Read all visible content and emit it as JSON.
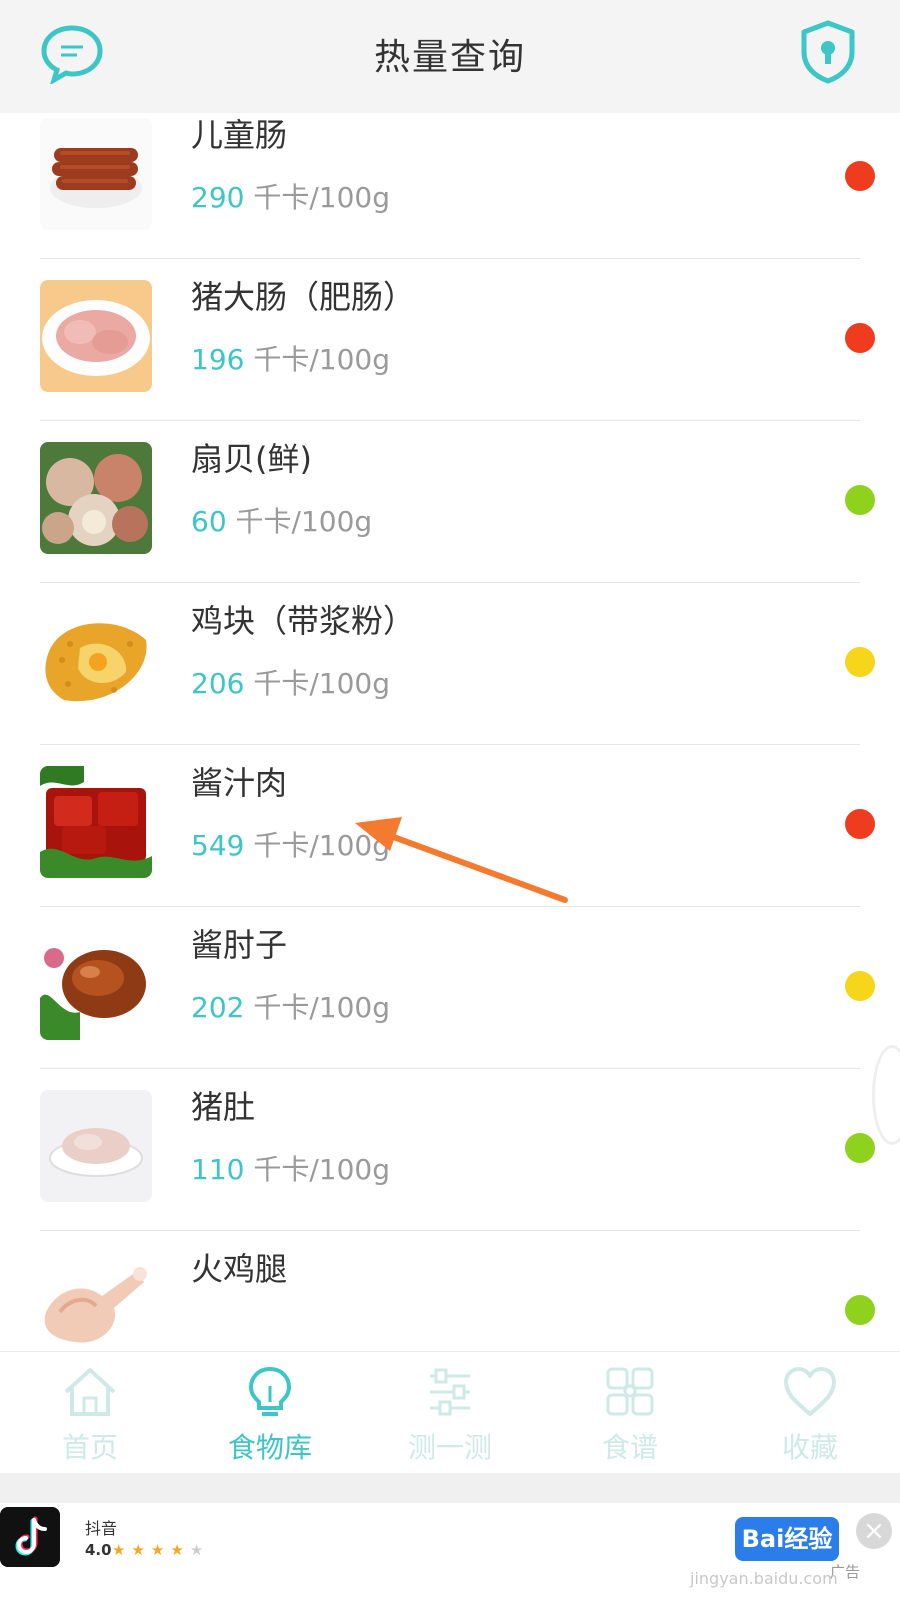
{
  "header": {
    "title": "热量查询",
    "left_icon": "chat-bubble-icon",
    "right_icon": "shield-lock-icon"
  },
  "foods": [
    {
      "name": "儿童肠",
      "kcal": "290",
      "unit": "千卡/100g",
      "level_color": "#f03c1e",
      "thumb": "sausage"
    },
    {
      "name": "猪大肠（肥肠）",
      "kcal": "196",
      "unit": "千卡/100g",
      "level_color": "#f03c1e",
      "thumb": "intestine"
    },
    {
      "name": "扇贝(鲜)",
      "kcal": "60",
      "unit": "千卡/100g",
      "level_color": "#8fd21e",
      "thumb": "scallop"
    },
    {
      "name": "鸡块（带浆粉）",
      "kcal": "206",
      "unit": "千卡/100g",
      "level_color": "#f7d51a",
      "thumb": "nugget"
    },
    {
      "name": "酱汁肉",
      "kcal": "549",
      "unit": "千卡/100g",
      "level_color": "#f03c1e",
      "thumb": "braised-pork"
    },
    {
      "name": "酱肘子",
      "kcal": "202",
      "unit": "千卡/100g",
      "level_color": "#f7d51a",
      "thumb": "pork-knuckle"
    },
    {
      "name": "猪肚",
      "kcal": "110",
      "unit": "千卡/100g",
      "level_color": "#8fd21e",
      "thumb": "tripe"
    },
    {
      "name": "火鸡腿",
      "kcal": "",
      "unit": "",
      "level_color": "#8fd21e",
      "thumb": "turkey-leg"
    }
  ],
  "tabs": [
    {
      "label": "首页",
      "icon": "home-icon",
      "active": false
    },
    {
      "label": "食物库",
      "icon": "lightbulb-icon",
      "active": true
    },
    {
      "label": "测一测",
      "icon": "sliders-icon",
      "active": false
    },
    {
      "label": "食谱",
      "icon": "grid-icon",
      "active": false
    },
    {
      "label": "收藏",
      "icon": "heart-icon",
      "active": false
    }
  ],
  "ad": {
    "app_name": "抖音",
    "rating": "4.0",
    "stars_filled": 4,
    "stars_total": 5,
    "cta_label": "Bai经验",
    "ad_tag": "广告",
    "watermark": "jingyan.baidu.com"
  },
  "colors": {
    "accent": "#3cc6c6",
    "high": "#f03c1e",
    "medium": "#f7d51a",
    "low": "#8fd21e",
    "annotation_arrow": "#f47a30"
  }
}
